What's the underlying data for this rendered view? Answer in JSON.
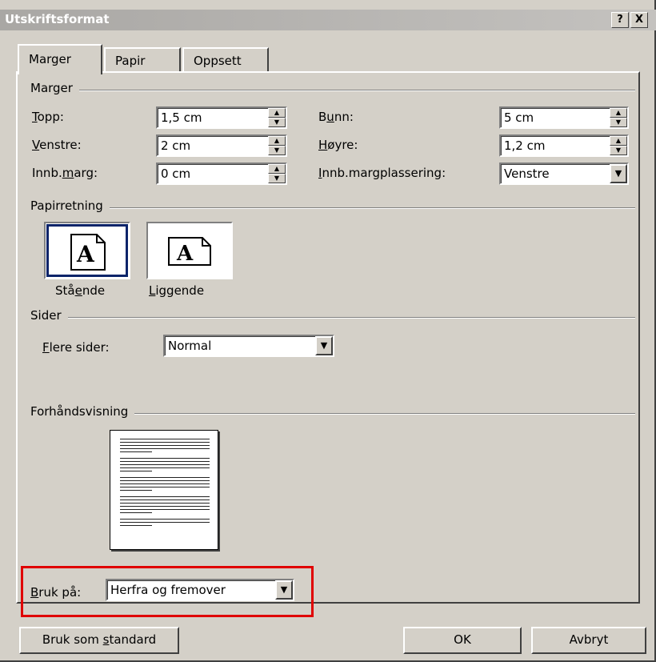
{
  "window": {
    "title": "Utskriftsformat",
    "help_label": "?",
    "close_label": "X"
  },
  "tabs": [
    "Marger",
    "Papir",
    "Oppsett"
  ],
  "margins": {
    "group_label": "Marger",
    "top": {
      "label_u": "T",
      "label_rest": "opp:",
      "value": "1,5 cm"
    },
    "left": {
      "label_u": "V",
      "label_rest": "enstre:",
      "value": "2 cm"
    },
    "gutter": {
      "label_pre": "Innb.",
      "label_u": "m",
      "label_rest": "arg:",
      "value": "0 cm"
    },
    "bottom": {
      "label_pre": "B",
      "label_u": "u",
      "label_rest": "nn:",
      "value": "5 cm"
    },
    "right": {
      "label_u": "H",
      "label_rest": "øyre:",
      "value": "1,2 cm"
    },
    "gutter_pos": {
      "label_u": "I",
      "label_rest": "nnb.margplassering:",
      "value": "Venstre"
    }
  },
  "orientation": {
    "group_label": "Papirretning",
    "portrait": {
      "label_pre": "Stå",
      "label_u": "e",
      "label_rest": "nde"
    },
    "landscape": {
      "label_u": "L",
      "label_rest": "iggende"
    },
    "glyph": "A"
  },
  "pages": {
    "group_label": "Sider",
    "multiple": {
      "label_u": "F",
      "label_rest": "lere sider:",
      "value": "Normal"
    }
  },
  "preview": {
    "group_label": "Forhåndsvisning",
    "apply_to": {
      "label_u": "B",
      "label_rest": "ruk på:",
      "value": "Herfra og fremover"
    }
  },
  "buttons": {
    "default_pre": "Bruk som ",
    "default_u": "s",
    "default_rest": "tandard",
    "ok": "OK",
    "cancel": "Avbryt"
  },
  "colors": {
    "dialog_bg": "#d4d0c8",
    "highlight_box": "#e00000",
    "selected_border": "#0a246a"
  }
}
